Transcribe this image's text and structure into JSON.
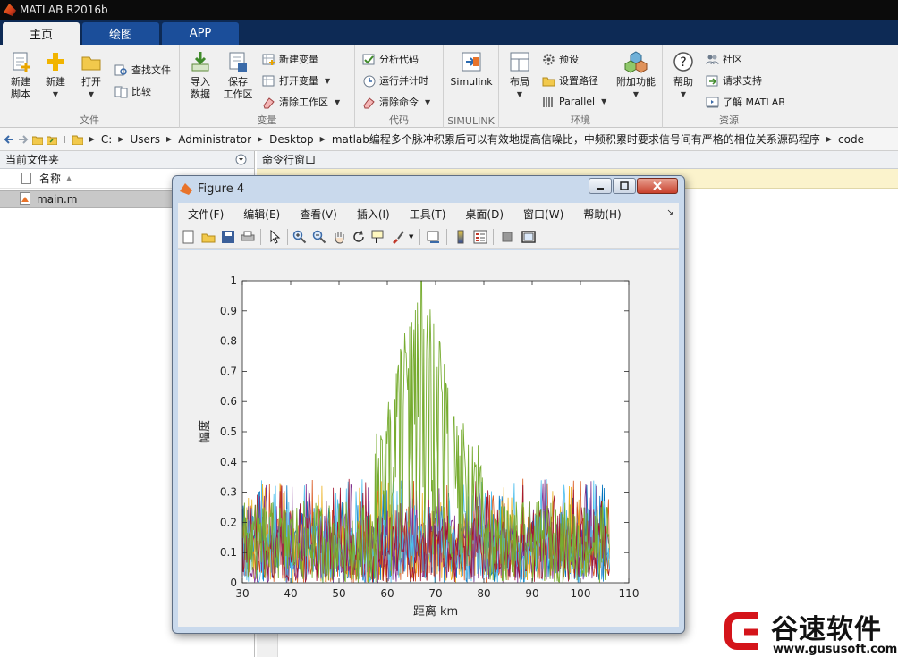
{
  "app": {
    "title": "MATLAB R2016b"
  },
  "tabs": [
    {
      "label": "主页",
      "active": true
    },
    {
      "label": "绘图",
      "active": false
    },
    {
      "label": "APP",
      "active": false
    }
  ],
  "ribbon": {
    "file": {
      "group_label": "文件",
      "new_script": "新建\n脚本",
      "new": "新建",
      "open": "打开",
      "find_files": "查找文件",
      "compare": "比较"
    },
    "variable": {
      "group_label": "变量",
      "import": "导入\n数据",
      "save_workspace": "保存\n工作区",
      "new_variable": "新建变量",
      "open_variable": "打开变量",
      "clear_workspace": "清除工作区"
    },
    "code": {
      "group_label": "代码",
      "analyze": "分析代码",
      "run_time": "运行并计时",
      "clear_commands": "清除命令"
    },
    "simulink": {
      "group_label": "SIMULINK",
      "label": "Simulink"
    },
    "env": {
      "group_label": "环境",
      "layout": "布局",
      "preferences": "预设",
      "set_path": "设置路径",
      "parallel": "Parallel",
      "addons": "附加功能"
    },
    "resources": {
      "group_label": "资源",
      "help": "帮助",
      "community": "社区",
      "request_support": "请求支持",
      "learn": "了解 MATLAB"
    }
  },
  "address": {
    "crumbs": [
      "C:",
      "Users",
      "Administrator",
      "Desktop",
      "matlab编程多个脉冲积累后可以有效地提高信噪比，中频积累时要求信号间有严格的相位关系源码程序",
      "code"
    ]
  },
  "current_folder": {
    "title": "当前文件夹",
    "column_name": "名称",
    "files": [
      "main.m"
    ]
  },
  "command_window": {
    "title": "命令行窗口"
  },
  "figure": {
    "title": "Figure 4",
    "menu": [
      "文件(F)",
      "编辑(E)",
      "查看(V)",
      "插入(I)",
      "工具(T)",
      "桌面(D)",
      "窗口(W)",
      "帮助(H)"
    ],
    "toolbar_icons": [
      "new-figure-icon",
      "open-icon",
      "save-icon",
      "print-icon",
      "pointer-icon",
      "zoom-in-icon",
      "zoom-out-icon",
      "pan-icon",
      "rotate-icon",
      "data-cursor-icon",
      "brush-icon",
      "link-icon",
      "colorbar-icon",
      "legend-icon",
      "hide-plot-tools-icon",
      "show-plot-tools-icon"
    ]
  },
  "chart_data": {
    "type": "line",
    "title": "",
    "xlabel": "距离 km",
    "ylabel": "幅度",
    "xlim": [
      30,
      110
    ],
    "ylim": [
      0,
      1
    ],
    "x_ticks": [
      "30",
      "40",
      "50",
      "60",
      "70",
      "80",
      "90",
      "100",
      "110"
    ],
    "y_ticks": [
      "0",
      "0.1",
      "0.2",
      "0.3",
      "0.4",
      "0.5",
      "0.6",
      "0.7",
      "0.8",
      "0.9",
      "1"
    ],
    "x_data_range": [
      30,
      106
    ],
    "noise_series_colors": [
      "#0072BD",
      "#D95319",
      "#EDB120",
      "#7E2F8E",
      "#4DBEEE",
      "#A2142F"
    ],
    "noise_level_max": 0.3,
    "signal_series": {
      "color": "#77AC30",
      "peak_x": 67,
      "peak_y": 1.0,
      "span": [
        57,
        80
      ]
    }
  },
  "watermark": {
    "brand": "谷速软件",
    "url": "www.gususoft.com"
  }
}
